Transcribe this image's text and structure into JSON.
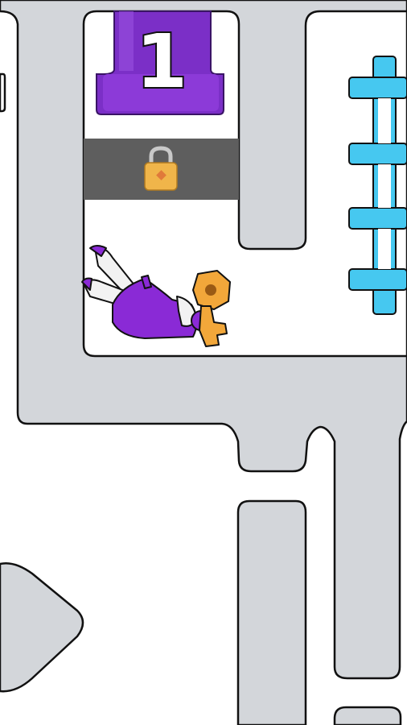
{
  "level": {
    "number": "1"
  },
  "colors": {
    "background": "#ffffff",
    "wall": "#d3d6da",
    "outline": "#111111",
    "pillar_purple": "#7b2fc7",
    "pillar_purple_dark": "#5a1e9c",
    "lock_bar": "#5e5e5e",
    "lock_gold": "#f0b54a",
    "fence_cyan": "#46c8f0",
    "character_purple": "#8a2ad6",
    "character_white": "#f2f2f2",
    "key_gold": "#f2a73a"
  },
  "icons": {
    "lock": "padlock-icon",
    "key": "key-icon",
    "pillar": "level-pillar",
    "fence": "cyan-fence-ladder"
  }
}
